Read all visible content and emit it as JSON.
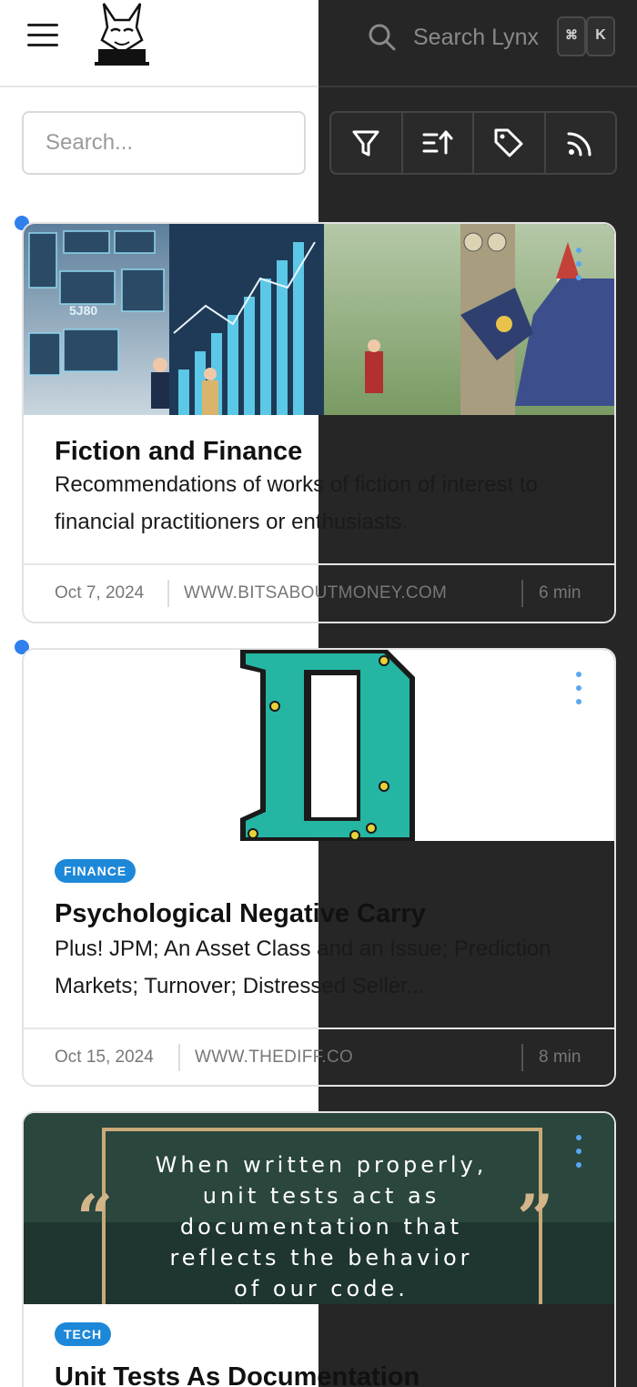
{
  "header": {
    "search_placeholder": "Search Lynx",
    "kbd_cmd": "⌘",
    "kbd_k": "K"
  },
  "filter_bar": {
    "search_placeholder": "Search..."
  },
  "cards": [
    {
      "title": "Fiction and Finance",
      "description": "Recommendations of works of fiction of interest to financial practitioners or enthusiasts.",
      "date": "Oct 7, 2024",
      "site": "WWW.BITSABOUTMONEY.COM",
      "read_time": "6 min"
    },
    {
      "tag": "FINANCE",
      "title": "Psychological Negative Carry",
      "description": "Plus! JPM; An Asset Class and an Issue; Prediction Markets; Turnover; Distressed Seller...",
      "date": "Oct 15, 2024",
      "site": "WWW.THEDIFF.CO",
      "read_time": "8 min"
    },
    {
      "quote": "When written properly, unit tests act as documentation that reflects the behavior of our code.",
      "tag": "TECH",
      "title": "Unit Tests As Documentation"
    }
  ],
  "colors": {
    "accent": "#2f80ed",
    "tag_bg": "#1e88d8",
    "dark_bg": "#262626"
  }
}
